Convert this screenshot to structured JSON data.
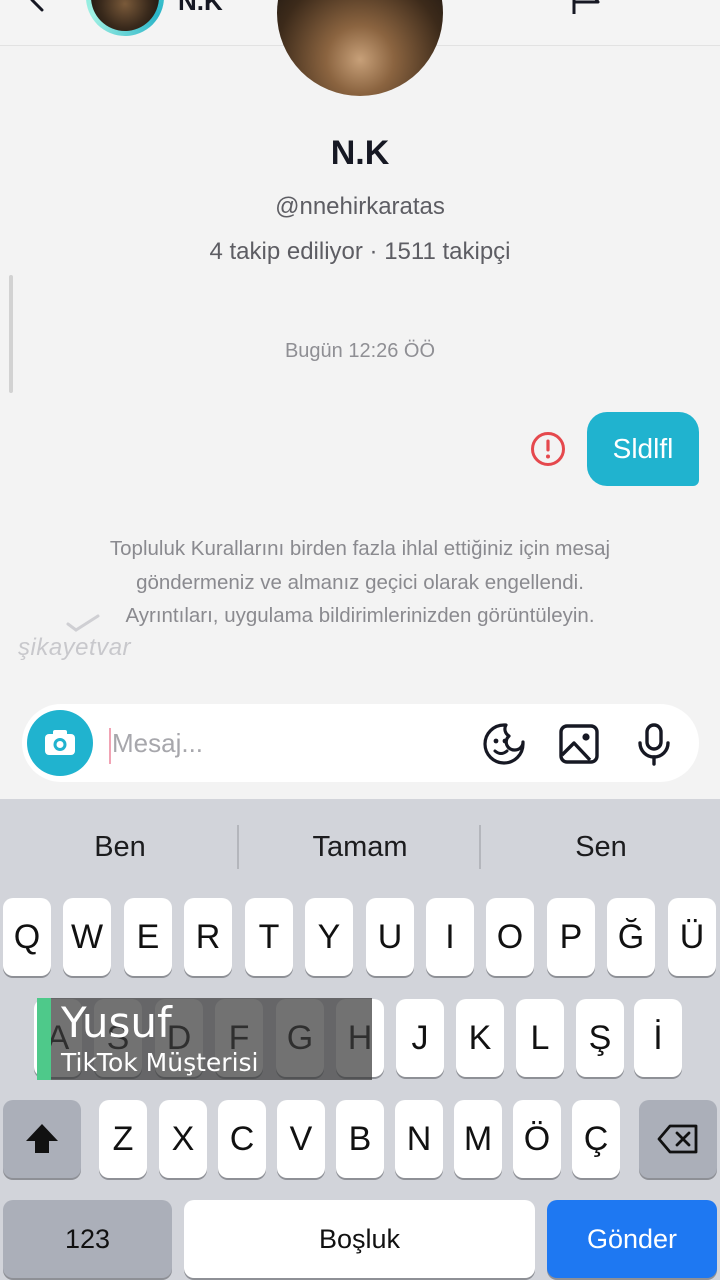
{
  "header": {
    "name": "N.K",
    "icons": [
      "back-arrow-icon",
      "flag-icon",
      "more-icon"
    ]
  },
  "profile": {
    "name": "N.K",
    "handle": "@nnehirkaratas",
    "stats": "4 takip ediliyor · 1511 takipçi"
  },
  "conversation": {
    "timestamp": "Bugün 12:26 ÖÖ",
    "messages": [
      {
        "text": "Sldlfl",
        "from": "me",
        "status": "failed",
        "status_icon": "error-icon"
      }
    ],
    "notice": "Topluluk Kurallarını birden fazla ihlal ettiğiniz için mesaj göndermeniz ve almanız geçici olarak engellendi. Ayrıntıları, uygulama bildirimlerinizden görüntüleyin."
  },
  "watermark": {
    "text": "şikayetvar"
  },
  "composer": {
    "placeholder": "Mesaj...",
    "icons": [
      "camera-icon",
      "sticker-icon",
      "image-icon",
      "microphone-icon"
    ]
  },
  "keyboard": {
    "suggestions": [
      "Ben",
      "Tamam",
      "Sen"
    ],
    "row1": [
      "Q",
      "W",
      "E",
      "R",
      "T",
      "Y",
      "U",
      "I",
      "O",
      "P",
      "Ğ",
      "Ü"
    ],
    "row2": [
      "A",
      "S",
      "D",
      "F",
      "G",
      "H",
      "J",
      "K",
      "L",
      "Ş",
      "İ"
    ],
    "row3": [
      "Z",
      "X",
      "C",
      "V",
      "B",
      "N",
      "M",
      "Ö",
      "Ç"
    ],
    "numbers_label": "123",
    "space_label": "Boşluk",
    "send_label": "Gönder"
  },
  "caption": {
    "name": "Yusuf",
    "role": "TikTok Müşterisi"
  },
  "colors": {
    "accent": "#20b3cf",
    "send_key": "#1e78f2",
    "error": "#e5484d",
    "caption_bar": "#4ec98a"
  }
}
